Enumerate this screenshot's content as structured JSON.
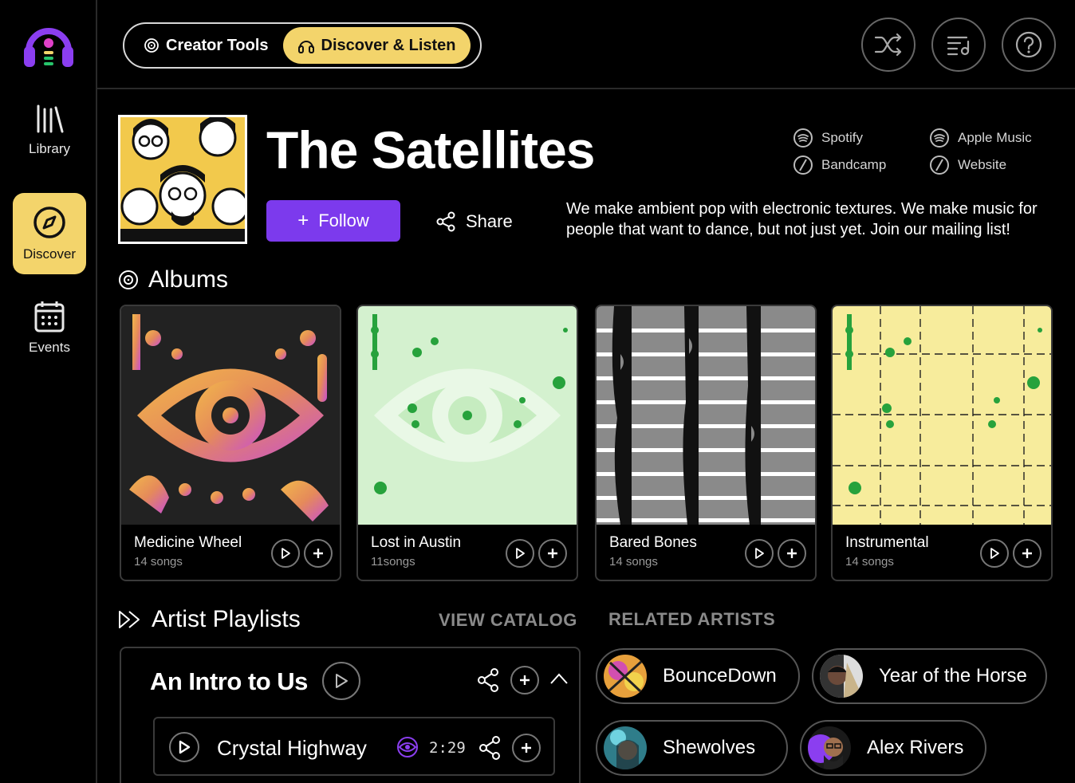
{
  "sidebar": {
    "items": [
      {
        "label": "Library",
        "icon": "library-icon"
      },
      {
        "label": "Discover",
        "icon": "compass-icon"
      },
      {
        "label": "Events",
        "icon": "calendar-icon"
      }
    ]
  },
  "topbar": {
    "modes": [
      {
        "label": "Creator Tools",
        "icon": "vinyl-icon"
      },
      {
        "label": "Discover & Listen",
        "icon": "headphones-icon"
      }
    ],
    "icons": [
      "shuffle-icon",
      "queue-icon",
      "help-icon"
    ]
  },
  "artist": {
    "name": "The Satellites",
    "follow_label": "Follow",
    "share_label": "Share",
    "links": [
      "Spotify",
      "Apple Music",
      "Bandcamp",
      "Website"
    ],
    "bio": "We make ambient pop with electronic textures. We make music for people that want to dance, but not just yet. Join our mailing list!"
  },
  "albums_section": {
    "title": "Albums",
    "items": [
      {
        "title": "Medicine Wheel",
        "count": "14 songs"
      },
      {
        "title": "Lost in Austin",
        "count": "11songs"
      },
      {
        "title": "Bared Bones",
        "count": "14 songs"
      },
      {
        "title": "Instrumental",
        "count": "14 songs"
      }
    ]
  },
  "playlists_section": {
    "title": "Artist Playlists",
    "view_catalog": "VIEW CATALOG",
    "playlist": {
      "name": "An Intro to Us",
      "track": {
        "name": "Crystal Highway",
        "time": "2:29"
      }
    }
  },
  "related_section": {
    "title": "RELATED ARTISTS",
    "artists": [
      "BounceDown",
      "Year of the Horse",
      "Shewolves",
      "Alex Rivers"
    ]
  },
  "colors": {
    "accent_yellow": "#f3d46b",
    "accent_purple": "#7c3aed"
  }
}
